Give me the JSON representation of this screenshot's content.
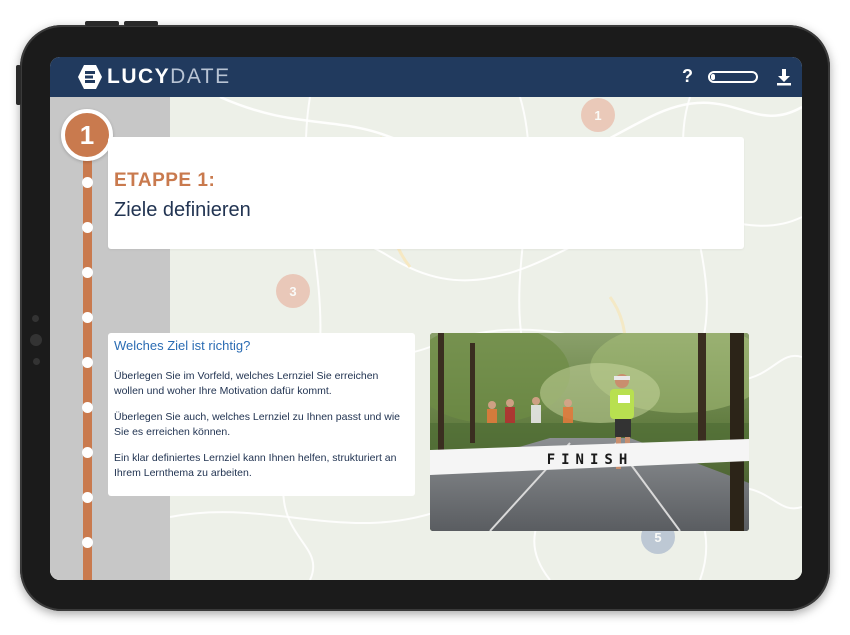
{
  "app": {
    "brand_bold": "LUCY",
    "brand_light": "DATE",
    "help_label": "?",
    "progress_fraction": 0.08,
    "icons": {
      "logo": "logo-e-icon",
      "download": "download-icon"
    },
    "colors": {
      "header": "#213a5e",
      "accent": "#c97a4e",
      "link": "#2b6cb3"
    }
  },
  "stage": {
    "number": "1",
    "label": "ETAPPE 1:",
    "title": "Ziele definieren"
  },
  "map_markers": [
    "1",
    "3",
    "5"
  ],
  "content": {
    "heading": "Welches Ziel ist richtig?",
    "paragraphs": [
      "Überlegen Sie im Vorfeld, welches Lernziel Sie erreichen wollen und woher Ihre Motivation dafür kommt.",
      "Überlegen Sie auch, welches Lernziel zu Ihnen passt und wie Sie es erreichen können.",
      "Ein klar definiertes Lernziel kann Ihnen helfen, strukturiert an Ihrem Lernthema zu arbeiten."
    ]
  },
  "photo": {
    "banner_text": "FINISH"
  }
}
